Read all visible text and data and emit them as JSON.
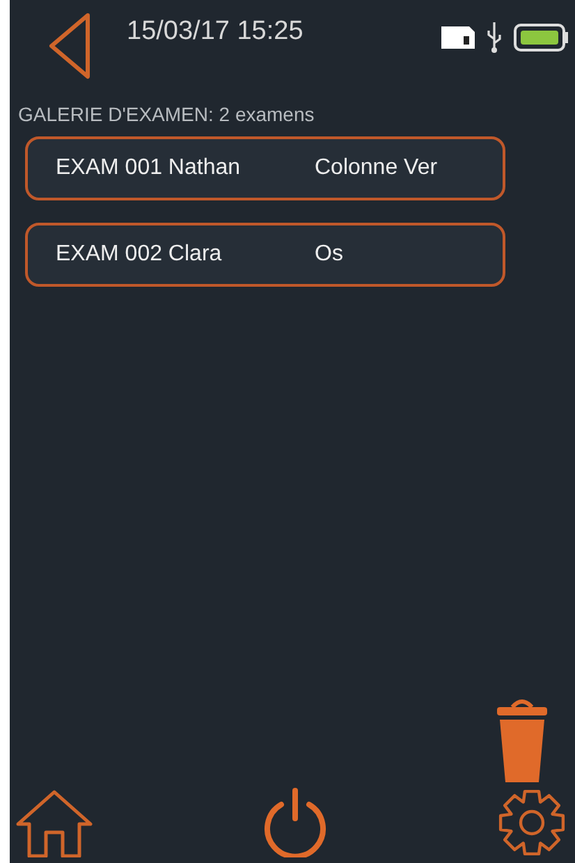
{
  "status_bar": {
    "datetime": "15/03/17 15:25"
  },
  "gallery": {
    "title": "GALERIE D'EXAMEN: 2 examens",
    "exams": [
      {
        "name": "EXAM 001 Nathan",
        "detail": "Colonne Ver"
      },
      {
        "name": "EXAM 002 Clara",
        "detail": "Os"
      }
    ]
  }
}
